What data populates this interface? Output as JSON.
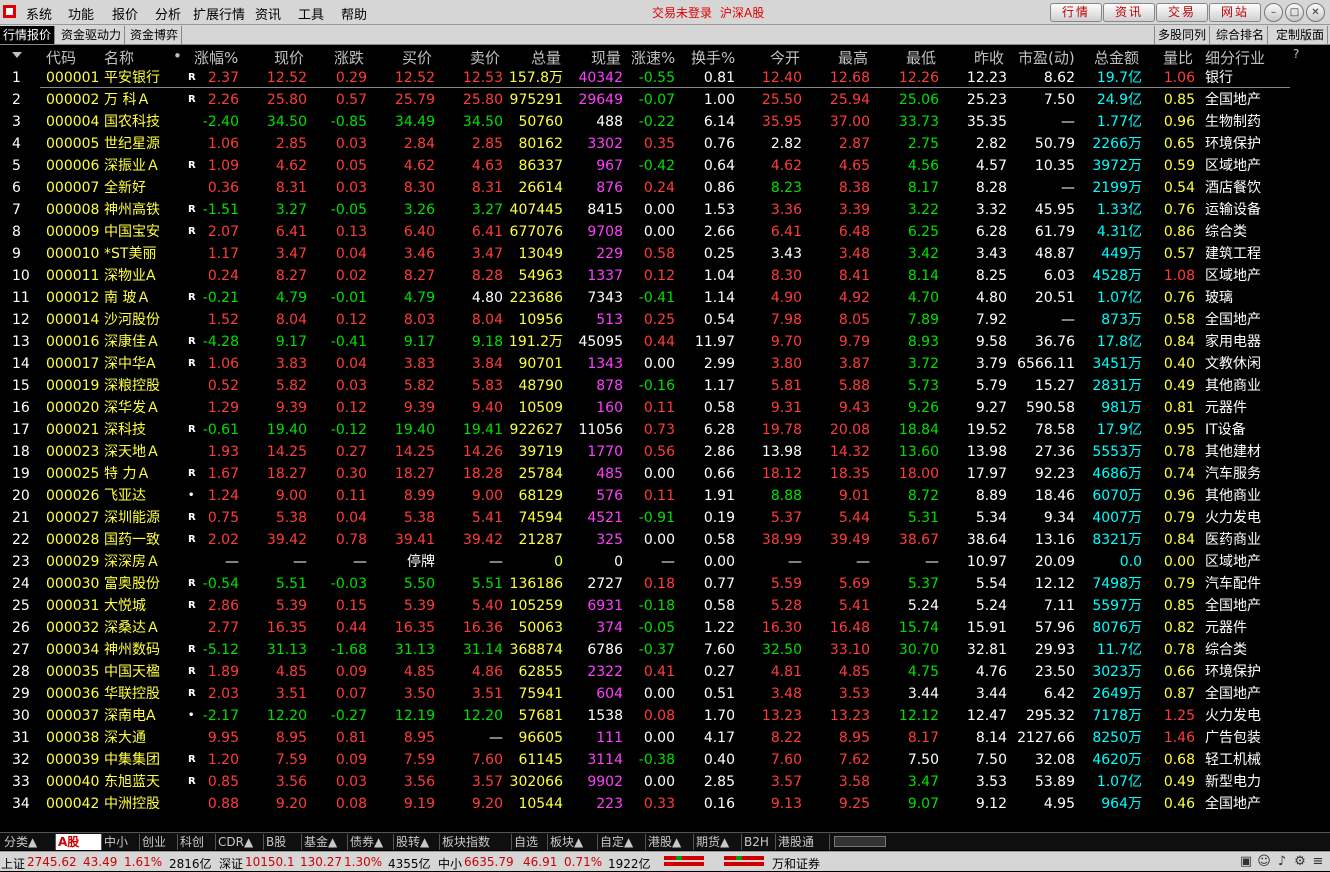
{
  "menubar": {
    "items": [
      "系统",
      "功能",
      "报价",
      "分析",
      "扩展行情",
      "资讯",
      "工具",
      "帮助"
    ],
    "status": "交易未登录",
    "market": "沪深A股",
    "buttons": [
      "行情",
      "资讯",
      "交易",
      "网站"
    ]
  },
  "tabs": {
    "left": [
      "行情报价",
      "资金驱动力",
      "资金博弈"
    ],
    "right": [
      "多股同列",
      "综合排名",
      "定制版面"
    ]
  },
  "columns": [
    "代码",
    "名称",
    "•",
    "涨幅%",
    "现价",
    "涨跌",
    "买价",
    "卖价",
    "总量",
    "现量",
    "涨速%",
    "换手%",
    "今开",
    "最高",
    "最低",
    "昨收",
    "市盈(动)",
    "总金额",
    "量比",
    "细分行业",
    "?"
  ],
  "rows": [
    [
      "1",
      "000001",
      "平安银行",
      "R",
      "2.37",
      "12.52",
      "0.29",
      "12.52",
      "12.53",
      "157.8万",
      "40342",
      "-0.55",
      "0.81",
      "12.40",
      "12.68",
      "12.26",
      "12.23",
      "8.62",
      "19.7亿",
      "1.06",
      "银行"
    ],
    [
      "2",
      "000002",
      "万 科Ａ",
      "R",
      "2.26",
      "25.80",
      "0.57",
      "25.79",
      "25.80",
      "975291",
      "29649",
      "-0.07",
      "1.00",
      "25.50",
      "25.94",
      "25.06",
      "25.23",
      "7.50",
      "24.9亿",
      "0.85",
      "全国地产"
    ],
    [
      "3",
      "000004",
      "国农科技",
      "",
      "-2.40",
      "34.50",
      "-0.85",
      "34.49",
      "34.50",
      "50760",
      "488",
      "-0.22",
      "6.14",
      "35.95",
      "37.00",
      "33.73",
      "35.35",
      "—",
      "1.77亿",
      "0.96",
      "生物制药"
    ],
    [
      "4",
      "000005",
      "世纪星源",
      "",
      "1.06",
      "2.85",
      "0.03",
      "2.84",
      "2.85",
      "80162",
      "3302",
      "0.35",
      "0.76",
      "2.82",
      "2.87",
      "2.75",
      "2.82",
      "50.79",
      "2266万",
      "0.65",
      "环境保护"
    ],
    [
      "5",
      "000006",
      "深振业Ａ",
      "R",
      "1.09",
      "4.62",
      "0.05",
      "4.62",
      "4.63",
      "86337",
      "967",
      "-0.42",
      "0.64",
      "4.62",
      "4.65",
      "4.56",
      "4.57",
      "10.35",
      "3972万",
      "0.59",
      "区域地产"
    ],
    [
      "6",
      "000007",
      "全新好",
      "",
      "0.36",
      "8.31",
      "0.03",
      "8.30",
      "8.31",
      "26614",
      "876",
      "0.24",
      "0.86",
      "8.23",
      "8.38",
      "8.17",
      "8.28",
      "—",
      "2199万",
      "0.54",
      "酒店餐饮"
    ],
    [
      "7",
      "000008",
      "神州高铁",
      "R",
      "-1.51",
      "3.27",
      "-0.05",
      "3.26",
      "3.27",
      "407445",
      "8415",
      "0.00",
      "1.53",
      "3.36",
      "3.39",
      "3.22",
      "3.32",
      "45.95",
      "1.33亿",
      "0.76",
      "运输设备"
    ],
    [
      "8",
      "000009",
      "中国宝安",
      "R",
      "2.07",
      "6.41",
      "0.13",
      "6.40",
      "6.41",
      "677076",
      "9708",
      "0.00",
      "2.66",
      "6.41",
      "6.48",
      "6.25",
      "6.28",
      "61.79",
      "4.31亿",
      "0.86",
      "综合类"
    ],
    [
      "9",
      "000010",
      "*ST美丽",
      "",
      "1.17",
      "3.47",
      "0.04",
      "3.46",
      "3.47",
      "13049",
      "229",
      "0.58",
      "0.25",
      "3.43",
      "3.48",
      "3.42",
      "3.43",
      "48.87",
      "449万",
      "0.57",
      "建筑工程"
    ],
    [
      "10",
      "000011",
      "深物业A",
      "",
      "0.24",
      "8.27",
      "0.02",
      "8.27",
      "8.28",
      "54963",
      "1337",
      "0.12",
      "1.04",
      "8.30",
      "8.41",
      "8.14",
      "8.25",
      "6.03",
      "4528万",
      "1.08",
      "区域地产"
    ],
    [
      "11",
      "000012",
      "南 玻Ａ",
      "R",
      "-0.21",
      "4.79",
      "-0.01",
      "4.79",
      "4.80",
      "223686",
      "7343",
      "-0.41",
      "1.14",
      "4.90",
      "4.92",
      "4.70",
      "4.80",
      "20.51",
      "1.07亿",
      "0.76",
      "玻璃"
    ],
    [
      "12",
      "000014",
      "沙河股份",
      "",
      "1.52",
      "8.04",
      "0.12",
      "8.03",
      "8.04",
      "10956",
      "513",
      "0.25",
      "0.54",
      "7.98",
      "8.05",
      "7.89",
      "7.92",
      "—",
      "873万",
      "0.58",
      "全国地产"
    ],
    [
      "13",
      "000016",
      "深康佳Ａ",
      "R",
      "-4.28",
      "9.17",
      "-0.41",
      "9.17",
      "9.18",
      "191.2万",
      "45095",
      "0.44",
      "11.97",
      "9.70",
      "9.79",
      "8.93",
      "9.58",
      "36.76",
      "17.8亿",
      "0.84",
      "家用电器"
    ],
    [
      "14",
      "000017",
      "深中华A",
      "R",
      "1.06",
      "3.83",
      "0.04",
      "3.83",
      "3.84",
      "90701",
      "1343",
      "0.00",
      "2.99",
      "3.80",
      "3.87",
      "3.72",
      "3.79",
      "6566.11",
      "3451万",
      "0.40",
      "文教休闲"
    ],
    [
      "15",
      "000019",
      "深粮控股",
      "",
      "0.52",
      "5.82",
      "0.03",
      "5.82",
      "5.83",
      "48790",
      "878",
      "-0.16",
      "1.17",
      "5.81",
      "5.88",
      "5.73",
      "5.79",
      "15.27",
      "2831万",
      "0.49",
      "其他商业"
    ],
    [
      "16",
      "000020",
      "深华发Ａ",
      "",
      "1.29",
      "9.39",
      "0.12",
      "9.39",
      "9.40",
      "10509",
      "160",
      "0.11",
      "0.58",
      "9.31",
      "9.43",
      "9.26",
      "9.27",
      "590.58",
      "981万",
      "0.81",
      "元器件"
    ],
    [
      "17",
      "000021",
      "深科技",
      "R",
      "-0.61",
      "19.40",
      "-0.12",
      "19.40",
      "19.41",
      "922627",
      "11056",
      "0.73",
      "6.28",
      "19.78",
      "20.08",
      "18.84",
      "19.52",
      "78.58",
      "17.9亿",
      "0.95",
      "IT设备"
    ],
    [
      "18",
      "000023",
      "深天地Ａ",
      "",
      "1.93",
      "14.25",
      "0.27",
      "14.25",
      "14.26",
      "39719",
      "1770",
      "0.56",
      "2.86",
      "13.98",
      "14.32",
      "13.60",
      "13.98",
      "27.36",
      "5553万",
      "0.78",
      "其他建材"
    ],
    [
      "19",
      "000025",
      "特 力Ａ",
      "R",
      "1.67",
      "18.27",
      "0.30",
      "18.27",
      "18.28",
      "25784",
      "485",
      "0.00",
      "0.66",
      "18.12",
      "18.35",
      "18.00",
      "17.97",
      "92.23",
      "4686万",
      "0.74",
      "汽车服务"
    ],
    [
      "20",
      "000026",
      "飞亚达",
      "•",
      "1.24",
      "9.00",
      "0.11",
      "8.99",
      "9.00",
      "68129",
      "576",
      "0.11",
      "1.91",
      "8.88",
      "9.01",
      "8.72",
      "8.89",
      "18.46",
      "6070万",
      "0.96",
      "其他商业"
    ],
    [
      "21",
      "000027",
      "深圳能源",
      "R",
      "0.75",
      "5.38",
      "0.04",
      "5.38",
      "5.41",
      "74594",
      "4521",
      "-0.91",
      "0.19",
      "5.37",
      "5.44",
      "5.31",
      "5.34",
      "9.34",
      "4007万",
      "0.79",
      "火力发电"
    ],
    [
      "22",
      "000028",
      "国药一致",
      "R",
      "2.02",
      "39.42",
      "0.78",
      "39.41",
      "39.42",
      "21287",
      "325",
      "0.00",
      "0.58",
      "38.99",
      "39.49",
      "38.67",
      "38.64",
      "13.16",
      "8321万",
      "0.84",
      "医药商业"
    ],
    [
      "23",
      "000029",
      "深深房Ａ",
      "",
      "—",
      "—",
      "—",
      "停牌",
      "—",
      "0",
      "0",
      "—",
      "0.00",
      "—",
      "—",
      "—",
      "10.97",
      "20.09",
      "0.0",
      "0.00",
      "区域地产"
    ],
    [
      "24",
      "000030",
      "富奥股份",
      "R",
      "-0.54",
      "5.51",
      "-0.03",
      "5.50",
      "5.51",
      "136186",
      "2727",
      "0.18",
      "0.77",
      "5.59",
      "5.69",
      "5.37",
      "5.54",
      "12.12",
      "7498万",
      "0.79",
      "汽车配件"
    ],
    [
      "25",
      "000031",
      "大悦城",
      "R",
      "2.86",
      "5.39",
      "0.15",
      "5.39",
      "5.40",
      "105259",
      "6931",
      "-0.18",
      "0.58",
      "5.28",
      "5.41",
      "5.24",
      "5.24",
      "7.11",
      "5597万",
      "0.85",
      "全国地产"
    ],
    [
      "26",
      "000032",
      "深桑达Ａ",
      "",
      "2.77",
      "16.35",
      "0.44",
      "16.35",
      "16.36",
      "50063",
      "374",
      "-0.05",
      "1.22",
      "16.30",
      "16.48",
      "15.74",
      "15.91",
      "57.96",
      "8076万",
      "0.82",
      "元器件"
    ],
    [
      "27",
      "000034",
      "神州数码",
      "R",
      "-5.12",
      "31.13",
      "-1.68",
      "31.13",
      "31.14",
      "368874",
      "6786",
      "-0.37",
      "7.60",
      "32.50",
      "33.10",
      "30.70",
      "32.81",
      "29.93",
      "11.7亿",
      "0.78",
      "综合类"
    ],
    [
      "28",
      "000035",
      "中国天楹",
      "R",
      "1.89",
      "4.85",
      "0.09",
      "4.85",
      "4.86",
      "62855",
      "2322",
      "0.41",
      "0.27",
      "4.81",
      "4.85",
      "4.75",
      "4.76",
      "23.50",
      "3023万",
      "0.66",
      "环境保护"
    ],
    [
      "29",
      "000036",
      "华联控股",
      "R",
      "2.03",
      "3.51",
      "0.07",
      "3.50",
      "3.51",
      "75941",
      "604",
      "0.00",
      "0.51",
      "3.48",
      "3.53",
      "3.44",
      "3.44",
      "6.42",
      "2649万",
      "0.87",
      "全国地产"
    ],
    [
      "30",
      "000037",
      "深南电A",
      "•",
      "-2.17",
      "12.20",
      "-0.27",
      "12.19",
      "12.20",
      "57681",
      "1538",
      "0.08",
      "1.70",
      "13.23",
      "13.23",
      "12.12",
      "12.47",
      "295.32",
      "7178万",
      "1.25",
      "火力发电"
    ],
    [
      "31",
      "000038",
      "深大通",
      "",
      "9.95",
      "8.95",
      "0.81",
      "8.95",
      "—",
      "96605",
      "111",
      "0.00",
      "4.17",
      "8.22",
      "8.95",
      "8.17",
      "8.14",
      "2127.66",
      "8250万",
      "1.46",
      "广告包装"
    ],
    [
      "32",
      "000039",
      "中集集团",
      "R",
      "1.20",
      "7.59",
      "0.09",
      "7.59",
      "7.60",
      "61145",
      "3114",
      "-0.38",
      "0.40",
      "7.60",
      "7.62",
      "7.50",
      "7.50",
      "32.08",
      "4620万",
      "0.68",
      "轻工机械"
    ],
    [
      "33",
      "000040",
      "东旭蓝天",
      "R",
      "0.85",
      "3.56",
      "0.03",
      "3.56",
      "3.57",
      "302066",
      "9902",
      "0.00",
      "2.85",
      "3.57",
      "3.58",
      "3.47",
      "3.53",
      "53.89",
      "1.07亿",
      "0.49",
      "新型电力"
    ],
    [
      "34",
      "000042",
      "中洲控股",
      "",
      "0.88",
      "9.20",
      "0.08",
      "9.19",
      "9.20",
      "10544",
      "223",
      "0.33",
      "0.16",
      "9.13",
      "9.25",
      "9.07",
      "9.12",
      "4.95",
      "964万",
      "0.46",
      "全国地产"
    ]
  ],
  "bottom_tabs": [
    "分类▲",
    "A股",
    "中小",
    "创业",
    "科创",
    "CDR▲",
    "B股",
    "基金▲",
    "债券▲",
    "股转▲",
    "板块指数",
    "自选",
    "板块▲",
    "自定▲",
    "港股▲",
    "期货▲",
    "B2H",
    "港股通"
  ],
  "statusbar": {
    "sh_label": "上证",
    "sh_value": "2745.62",
    "sh_change": "43.49",
    "sh_pct": "1.61%",
    "sh_amount": "2816亿",
    "sz_label": "深证",
    "sz_value": "10150.1",
    "sz_change": "130.27",
    "sz_pct": "1.30%",
    "sz_amount": "4355亿",
    "zx_label": "中小",
    "zx_value": "6635.79",
    "zx_change": "46.91",
    "zx_pct": "0.71%",
    "zx_amount": "1922亿",
    "broker": "万和证券"
  },
  "colors": {
    "up": "#ff3c3c",
    "down": "#00e000",
    "flat": "#ffffff",
    "code": "#ffff40",
    "name": "#ffff40",
    "amount": "#00ffff",
    "volume": "#ff40ff",
    "industry": "#ffffff"
  }
}
